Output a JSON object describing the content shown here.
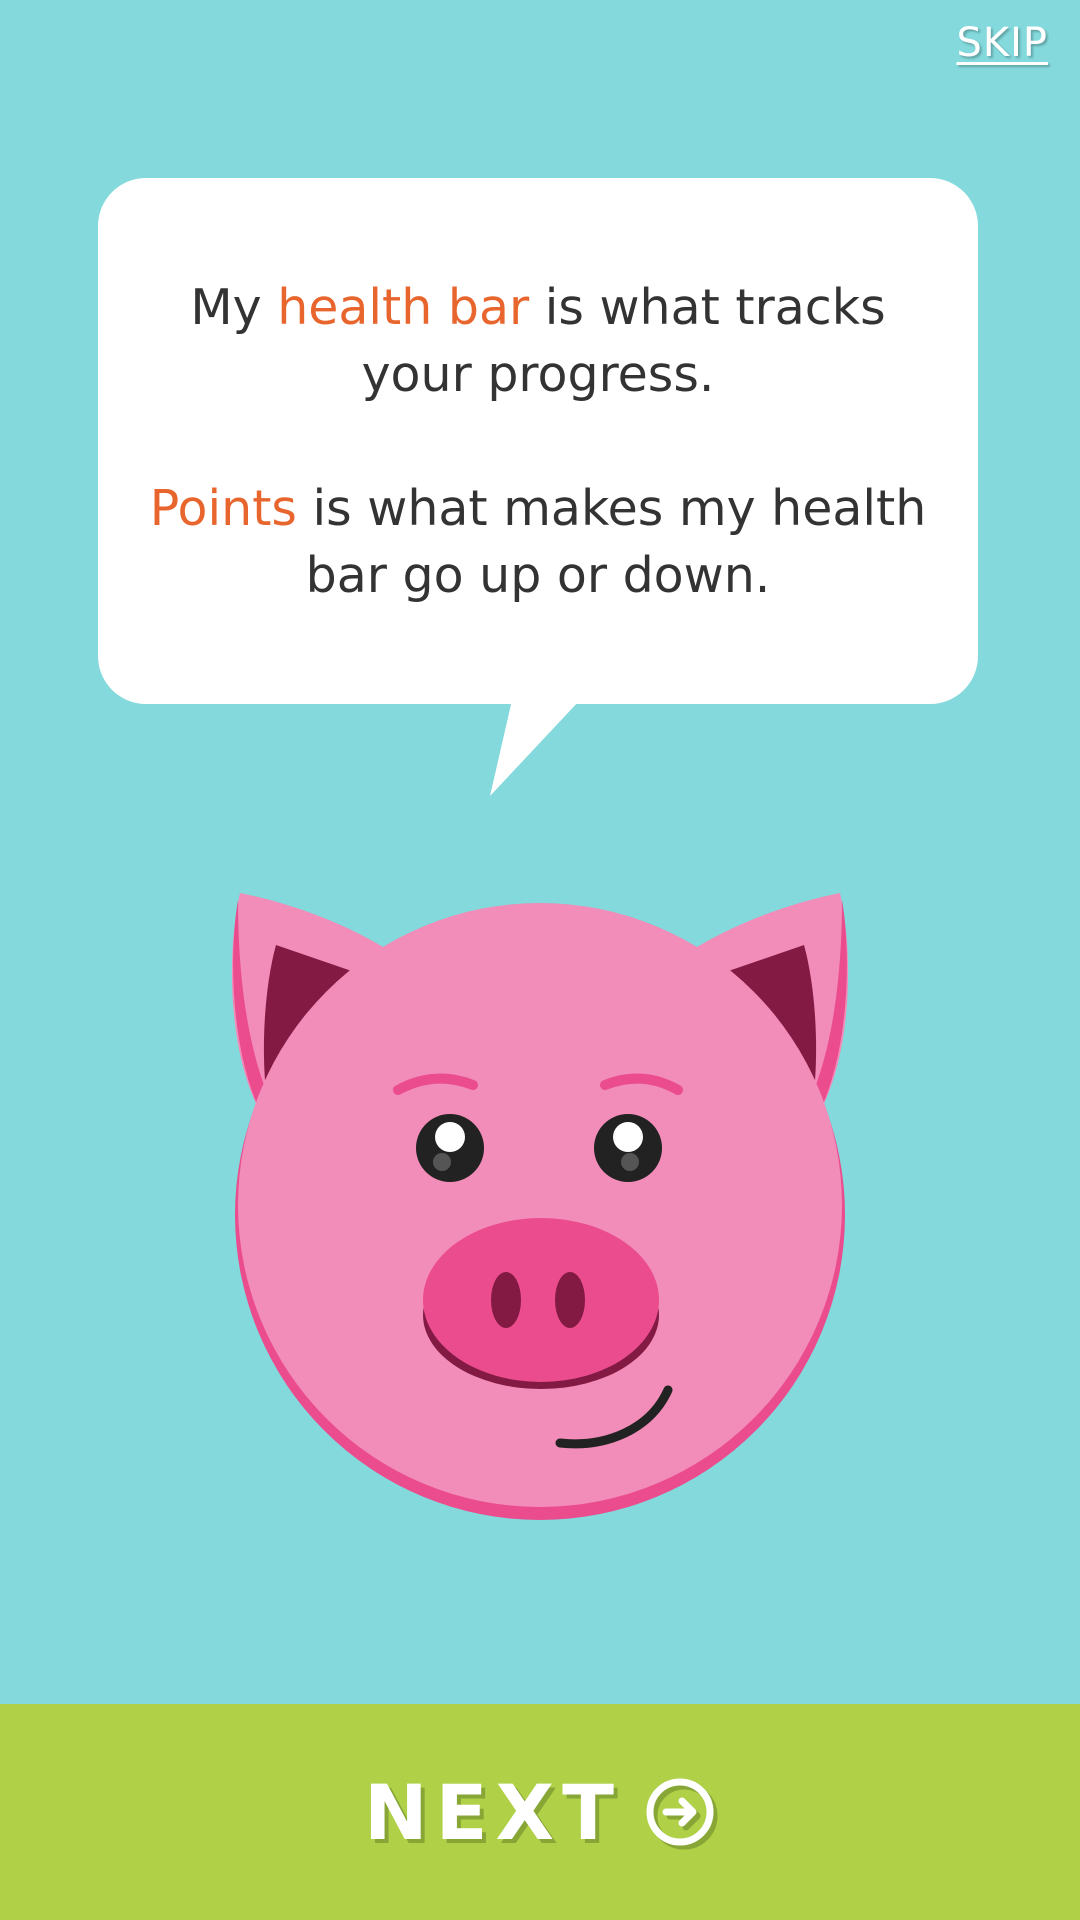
{
  "header": {
    "skip_label": "SKIP"
  },
  "bubble": {
    "line1_prefix": "My ",
    "line1_highlight": "health bar",
    "line1_suffix": " is what tracks your progress.",
    "line2_highlight": "Points",
    "line2_suffix": " is what makes my health bar go up or down."
  },
  "mascot": {
    "icon": "pig-icon"
  },
  "footer": {
    "next_label": "NEXT",
    "next_icon": "arrow-circle-right-icon"
  },
  "colors": {
    "background": "#83d9dc",
    "highlight": "#e8662d",
    "next_bar": "#afd047",
    "pig_pink": "#f28cb8",
    "pig_dark_pink": "#ea4c8e",
    "pig_ear_inner": "#831a44"
  }
}
